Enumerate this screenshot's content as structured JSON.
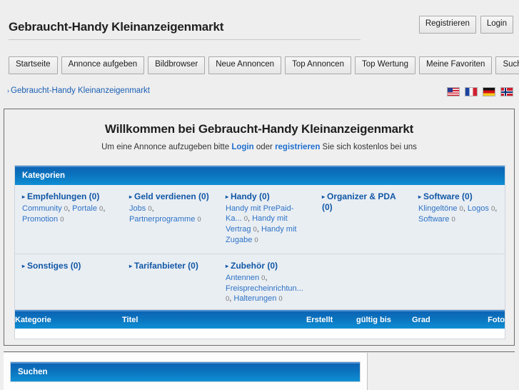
{
  "header": {
    "site_title": "Gebraucht-Handy Kleinanzeigenmarkt",
    "register_label": "Registrieren",
    "login_label": "Login"
  },
  "nav": {
    "items": [
      {
        "label": "Startseite"
      },
      {
        "label": "Annonce aufgeben"
      },
      {
        "label": "Bildbrowser"
      },
      {
        "label": "Neue Annoncen"
      },
      {
        "label": "Top Annoncen"
      },
      {
        "label": "Top Wertung"
      },
      {
        "label": "Meine Favoriten"
      },
      {
        "label": "Suchen"
      }
    ]
  },
  "breadcrumb": {
    "arrow": "›",
    "text": "Gebraucht-Handy Kleinanzeigenmarkt"
  },
  "languages": [
    {
      "name": "flag-us-icon",
      "title": "English"
    },
    {
      "name": "flag-fr-icon",
      "title": "Français"
    },
    {
      "name": "flag-de-icon",
      "title": "Deutsch"
    },
    {
      "name": "flag-no-icon",
      "title": "Norsk"
    }
  ],
  "welcome": {
    "title": "Willkommen bei Gebraucht-Handy Kleinanzeigenmarkt",
    "lead": "Um eine Annonce aufzugeben bitte ",
    "login_link": "Login",
    "middle": " oder ",
    "register_link": "registrieren",
    "tail": " Sie sich kostenlos bei uns"
  },
  "categories": {
    "panel_title": "Kategorien",
    "row1": [
      {
        "title": "Empfehlungen (0)",
        "subs": [
          {
            "label": "Community",
            "count": "0"
          },
          {
            "label": "Portale",
            "count": "0"
          },
          {
            "label": "Promotion",
            "count": "0"
          }
        ]
      },
      {
        "title": "Geld verdienen (0)",
        "subs": [
          {
            "label": "Jobs",
            "count": "0"
          },
          {
            "label": "Partnerprogramme",
            "count": "0"
          }
        ]
      },
      {
        "title": "Handy (0)",
        "subs": [
          {
            "label": "Handy mit PrePaid-Ka...",
            "count": "0"
          },
          {
            "label": "Handy mit Vertrag",
            "count": "0"
          },
          {
            "label": "Handy mit Zugabe",
            "count": "0"
          }
        ]
      },
      {
        "title": "Organizer & PDA (0)",
        "subs": []
      },
      {
        "title": "Software (0)",
        "subs": [
          {
            "label": "Klingeltöne",
            "count": "0"
          },
          {
            "label": "Logos",
            "count": "0"
          },
          {
            "label": "Software",
            "count": "0"
          }
        ]
      }
    ],
    "row2": [
      {
        "title": "Sonstiges (0)",
        "subs": []
      },
      {
        "title": "Tarifanbieter (0)",
        "subs": []
      },
      {
        "title": "Zubehör (0)",
        "subs": [
          {
            "label": "Antennen",
            "count": "0"
          },
          {
            "label": "Freisprecheinrichtun...",
            "count": "0"
          },
          {
            "label": "Halterungen",
            "count": "0"
          }
        ]
      }
    ]
  },
  "listing": {
    "columns": [
      {
        "key": "kategorie",
        "label": "Kategorie"
      },
      {
        "key": "titel",
        "label": "Titel"
      },
      {
        "key": "erstellt",
        "label": "Erstellt"
      },
      {
        "key": "gueltig",
        "label": "gültig bis"
      },
      {
        "key": "grad",
        "label": "Grad"
      },
      {
        "key": "foto",
        "label": "Foto"
      }
    ],
    "rows": []
  },
  "search_panel": {
    "title": "Suchen"
  },
  "colors": {
    "page_bg": "#eeeeee",
    "panel_bg": "#efefef",
    "accent_blue": "#0b72bd",
    "accent_blue_light": "#0e8fd4",
    "link_blue": "#2d72c6",
    "heading_blue": "#1157a6",
    "border_dark": "#6d6d6d"
  }
}
